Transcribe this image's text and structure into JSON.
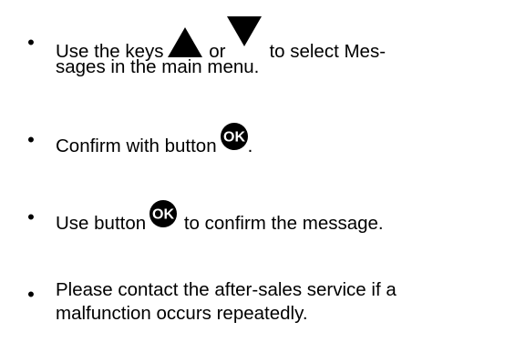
{
  "bullets": [
    {
      "part1": "Use the keys",
      "icon_up": "up-arrow-key-icon",
      "part2": "or",
      "icon_down": "down-arrow-key-icon",
      "part3": "to select Mes-",
      "line2": "sages in the main menu."
    },
    {
      "part1": "Confirm with button",
      "icon_ok": "ok-button-icon",
      "part2": "."
    },
    {
      "part1": "Use button",
      "icon_ok": "ok-button-icon",
      "part2": "to confirm the message."
    },
    {
      "line1": "Please contact the after-sales service if a",
      "line2": "malfunction occurs repeatedly."
    }
  ],
  "bullet_glyph": "•",
  "icon_colors": {
    "key_fill": "#000000",
    "ok_text": "#ffffff"
  },
  "ok_label": "OK"
}
